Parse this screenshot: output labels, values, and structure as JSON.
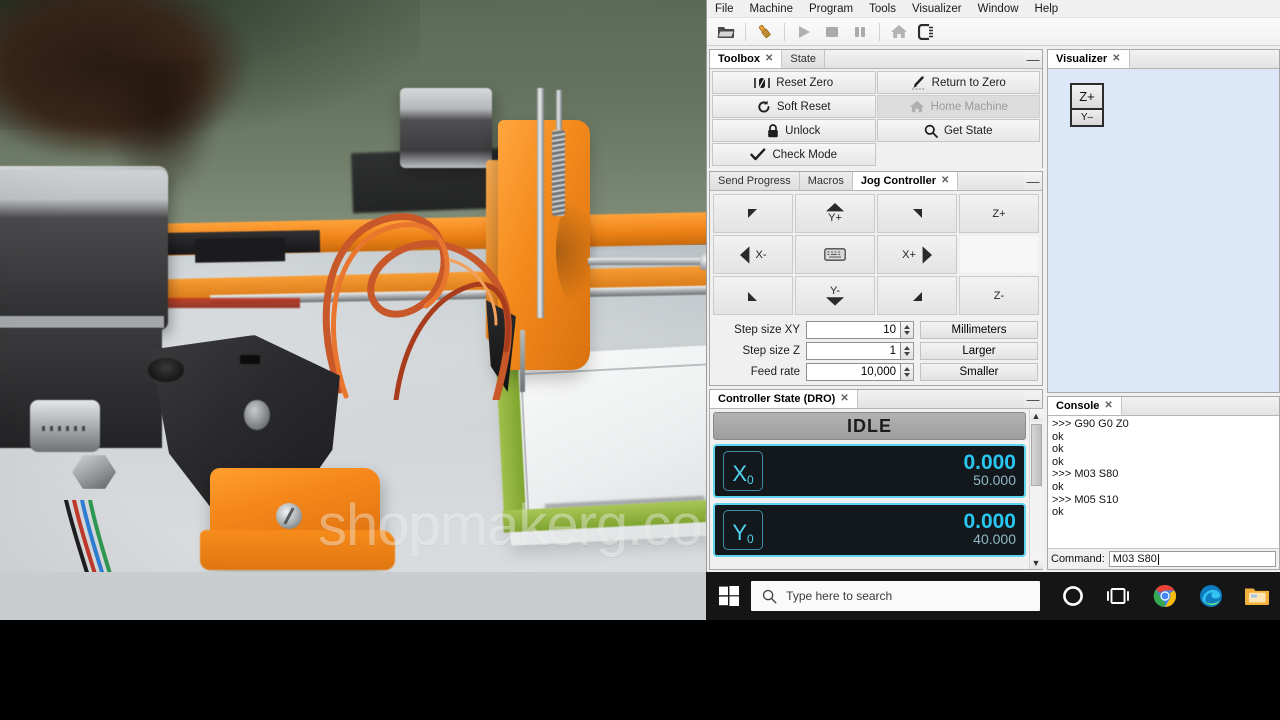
{
  "window": {
    "menu": [
      "File",
      "Machine",
      "Program",
      "Tools",
      "Visualizer",
      "Window",
      "Help"
    ],
    "toolbar": [
      {
        "name": "open-file-icon",
        "label": "Open"
      },
      {
        "name": "drill-bit-icon",
        "label": "Bit Setup"
      },
      {
        "name": "play-icon",
        "label": "Send"
      },
      {
        "name": "stop-icon",
        "label": "Stop"
      },
      {
        "name": "pause-icon",
        "label": "Pause"
      },
      {
        "name": "home-icon",
        "label": "Home"
      },
      {
        "name": "connect-icon",
        "label": "Connect"
      }
    ]
  },
  "toolbox": {
    "tabs": [
      {
        "label": "Toolbox",
        "active": true,
        "closable": true
      },
      {
        "label": "State",
        "active": false,
        "closable": false
      }
    ],
    "minimize": "—",
    "buttons": [
      {
        "label": "Reset Zero",
        "icon": "reset-zero-icon",
        "disabled": false
      },
      {
        "label": "Return to Zero",
        "icon": "return-to-zero-icon",
        "disabled": false
      },
      {
        "label": "Soft Reset",
        "icon": "soft-reset-icon",
        "disabled": false
      },
      {
        "label": "Home Machine",
        "icon": "home-machine-icon",
        "disabled": true
      },
      {
        "label": "Unlock",
        "icon": "lock-icon",
        "disabled": false
      },
      {
        "label": "Get State",
        "icon": "search-icon",
        "disabled": false
      },
      {
        "label": "Check Mode",
        "icon": "check-icon",
        "disabled": false
      }
    ]
  },
  "jog": {
    "tabs": [
      {
        "label": "Send Progress",
        "active": false,
        "closable": false
      },
      {
        "label": "Macros",
        "active": false,
        "closable": false
      },
      {
        "label": "Jog Controller",
        "active": true,
        "closable": true
      }
    ],
    "minimize": "—",
    "pad": [
      {
        "name": "jog-xminus-yplus",
        "label": "",
        "glyph": "diag-up-left"
      },
      {
        "name": "jog-yplus",
        "label": "Y+",
        "glyph": "arrow-up"
      },
      {
        "name": "jog-xplus-yplus",
        "label": "",
        "glyph": "diag-up-right"
      },
      {
        "name": "jog-zplus",
        "label": "Z+",
        "glyph": "none"
      },
      {
        "name": "jog-xminus",
        "label": "X-",
        "glyph": "arrow-left"
      },
      {
        "name": "jog-keyboard",
        "label": "",
        "glyph": "keyboard"
      },
      {
        "name": "jog-xplus",
        "label": "X+",
        "glyph": "arrow-right"
      },
      {
        "name": "jog-blank",
        "label": "",
        "glyph": "none"
      },
      {
        "name": "jog-xminus-yminus",
        "label": "",
        "glyph": "diag-down-left"
      },
      {
        "name": "jog-yminus",
        "label": "Y-",
        "glyph": "arrow-down"
      },
      {
        "name": "jog-xplus-yminus",
        "label": "",
        "glyph": "diag-down-right"
      },
      {
        "name": "jog-zminus",
        "label": "Z-",
        "glyph": "none"
      }
    ],
    "fields": [
      {
        "label": "Step size XY",
        "value": "10",
        "button": "Millimeters"
      },
      {
        "label": "Step size Z",
        "value": "1",
        "button": "Larger"
      },
      {
        "label": "Feed rate",
        "value": "10,000",
        "button": "Smaller"
      }
    ]
  },
  "dro": {
    "tabs": [
      {
        "label": "Controller State (DRO)",
        "active": true,
        "closable": true
      }
    ],
    "minimize": "—",
    "state": "IDLE",
    "axes": [
      {
        "axis": "X",
        "zero": "0",
        "work": "0.000",
        "machine": "50.000"
      },
      {
        "axis": "Y",
        "zero": "0",
        "work": "0.000",
        "machine": "40.000"
      }
    ]
  },
  "visualizer": {
    "tabs": [
      {
        "label": "Visualizer",
        "active": true,
        "closable": true
      }
    ],
    "cube": {
      "top": "Z+",
      "bottom": "Y–"
    }
  },
  "console": {
    "tabs": [
      {
        "label": "Console",
        "active": true,
        "closable": true
      }
    ],
    "log": [
      ">>> G90 G0 Z0",
      "ok",
      "ok",
      "ok",
      ">>> M03 S80",
      "ok",
      ">>> M05 S10",
      "ok"
    ],
    "command_label": "Command:",
    "command_value": "M03 S80"
  },
  "taskbar": {
    "start": "start-button",
    "search_placeholder": "Type here to search",
    "icons": [
      {
        "name": "cortana-icon",
        "label": "Cortana"
      },
      {
        "name": "task-view-icon",
        "label": "Task View"
      },
      {
        "name": "chrome-icon",
        "label": "Google Chrome"
      },
      {
        "name": "edge-icon",
        "label": "Microsoft Edge"
      },
      {
        "name": "file-explorer-icon",
        "label": "File Explorer"
      }
    ]
  },
  "photo": {
    "watermark": "shopmakerg.com"
  },
  "colors": {
    "accent_cyan": "#29c6f0",
    "dro_background": "#13181c",
    "orange_plastic": "#f4881a",
    "taskbar": "#151515"
  }
}
